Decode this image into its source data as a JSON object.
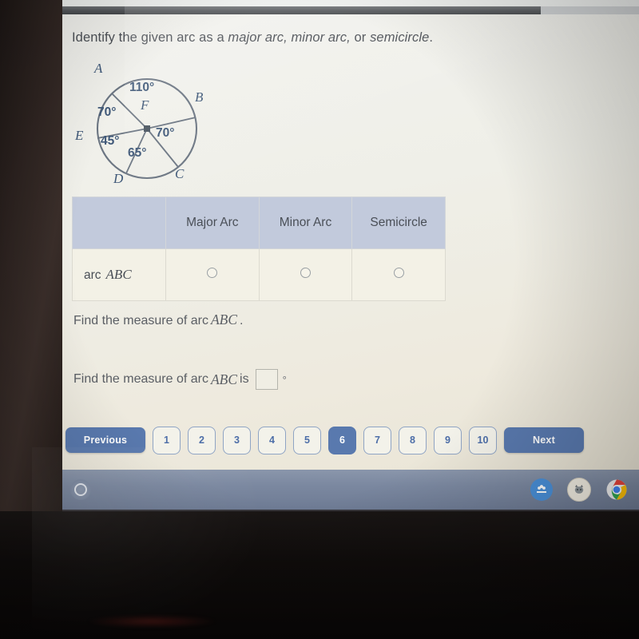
{
  "window": {
    "scrollbar": {
      "name": "horizontal-scrollbar",
      "thumb_percent": 83
    }
  },
  "question": {
    "lead": "Identify the given arc as a ",
    "term_major": "major arc,",
    "term_minor": " minor arc,",
    "conj": " or ",
    "term_semi": "semicircle",
    "period": "."
  },
  "figure": {
    "name": "circle-diagram",
    "center_label": "F",
    "point_labels": [
      "A",
      "B",
      "C",
      "D",
      "E"
    ],
    "angles": [
      {
        "value": "110°",
        "between": "A-B"
      },
      {
        "value": "70°",
        "between": "B-C"
      },
      {
        "value": "65°",
        "between": "C-D"
      },
      {
        "value": "45°",
        "between": "D-E"
      },
      {
        "value": "70°",
        "between": "E-A"
      }
    ],
    "stroke_color": "#6b7582",
    "label_color": "#3f5878"
  },
  "table": {
    "corner_header": "",
    "headers": [
      "Major Arc",
      "Minor Arc",
      "Semicircle"
    ],
    "rows": [
      {
        "label_prefix": "arc",
        "label_arc": "ABC",
        "options": [
          "Major Arc",
          "Minor Arc",
          "Semicircle"
        ],
        "selected": null
      }
    ],
    "header_bg": "#c2cadc",
    "body_bg": "#f3f1e6"
  },
  "prompts": {
    "first": {
      "lead": "Find the measure of arc",
      "arc": "ABC",
      "tail": "."
    },
    "second": {
      "lead": "Find the measure of arc",
      "arc": "ABC",
      "mid": "is",
      "unit": "°",
      "input_value": ""
    }
  },
  "pagination": {
    "previous_label": "Previous",
    "next_label": "Next",
    "pages": [
      "1",
      "2",
      "3",
      "4",
      "5",
      "6",
      "7",
      "8",
      "9",
      "10"
    ],
    "active_page": "6",
    "accent_color": "#5979ae"
  },
  "shelf": {
    "launcher_name": "launcher-button",
    "tray_icons": [
      "google-classroom-icon",
      "cat-app-icon",
      "chrome-icon"
    ]
  }
}
